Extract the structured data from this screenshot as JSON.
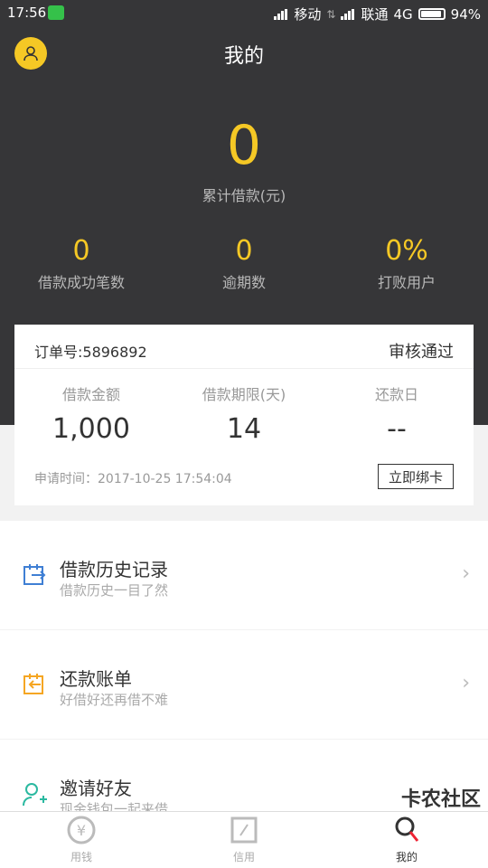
{
  "status_bar": {
    "time": "17:56",
    "carrier1": "移动",
    "carrier2": "联通",
    "network": "4G",
    "battery": "94%"
  },
  "header": {
    "title": "我的"
  },
  "summary": {
    "total_value": "0",
    "total_label": "累计借款(元)"
  },
  "stats": [
    {
      "value": "0",
      "label": "借款成功笔数"
    },
    {
      "value": "0",
      "label": "逾期数"
    },
    {
      "value": "0%",
      "label": "打败用户"
    }
  ],
  "order_card": {
    "order_no": "订单号:5896892",
    "status": "审核通过",
    "columns": [
      {
        "label": "借款金额",
        "value": "1,000"
      },
      {
        "label": "借款期限(天)",
        "value": "14"
      },
      {
        "label": "还款日",
        "value": "--"
      }
    ],
    "apply_time": "申请时间：2017-10-25 17:54:04",
    "bind_button": "立即绑卡"
  },
  "menu": [
    {
      "title": "借款历史记录",
      "subtitle": "借款历史一目了然",
      "icon": "history-calendar-icon",
      "color": "#3f7fd4"
    },
    {
      "title": "还款账单",
      "subtitle": "好借好还再借不难",
      "icon": "repay-calendar-icon",
      "color": "#f5a623"
    },
    {
      "title": "邀请好友",
      "subtitle": "现金钱包一起来借",
      "icon": "add-user-icon",
      "color": "#2bb9a0"
    }
  ],
  "tabs": [
    {
      "label": "用钱",
      "icon": "yuan-icon"
    },
    {
      "label": "信用",
      "icon": "credit-icon"
    },
    {
      "label": "我的",
      "icon": "profile-icon"
    }
  ],
  "watermark": "卡农社区",
  "colors": {
    "accent": "#f5c825",
    "dark_bg": "#363638"
  }
}
